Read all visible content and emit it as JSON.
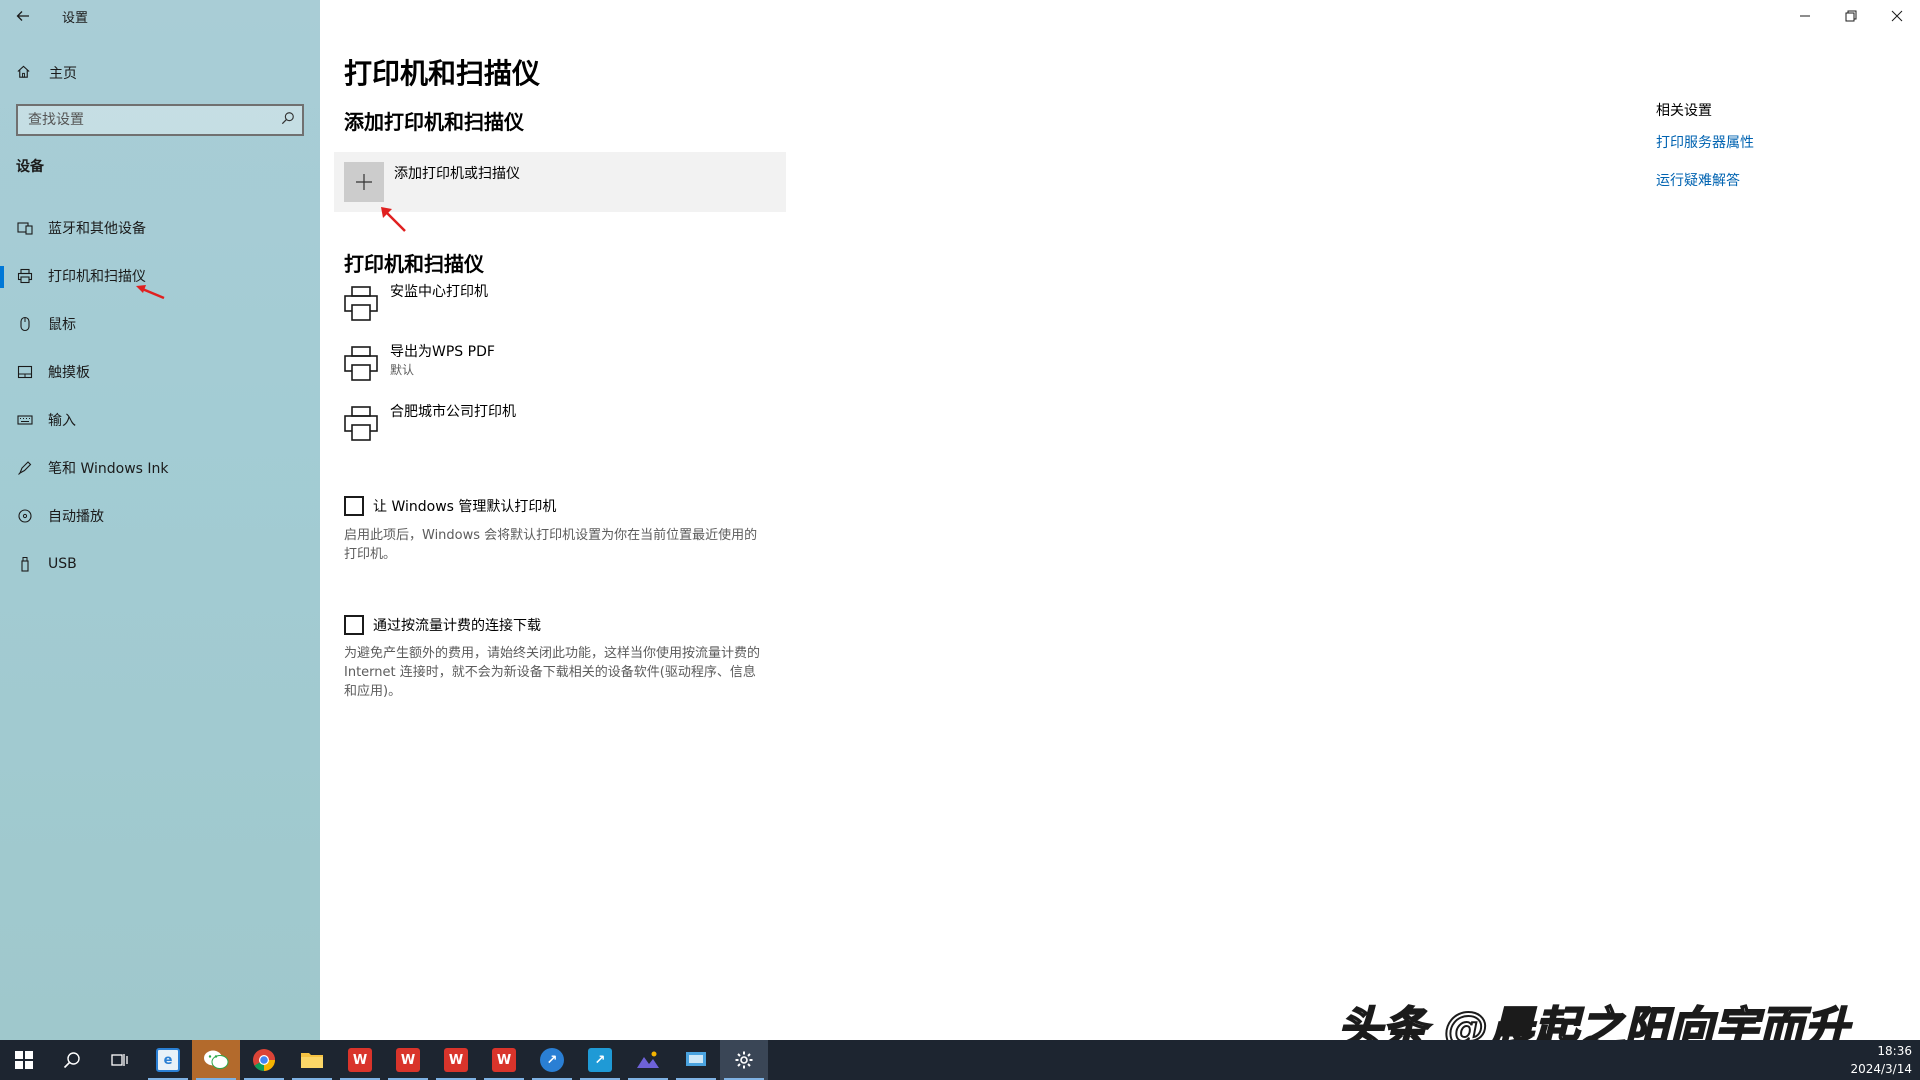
{
  "window": {
    "title": "设置"
  },
  "sidebar": {
    "home_label": "主页",
    "search_placeholder": "查找设置",
    "section": "设备",
    "items": [
      {
        "label": "蓝牙和其他设备",
        "icon": "bluetooth-devices-icon"
      },
      {
        "label": "打印机和扫描仪",
        "icon": "printer-icon",
        "active": true
      },
      {
        "label": "鼠标",
        "icon": "mouse-icon"
      },
      {
        "label": "触摸板",
        "icon": "touchpad-icon"
      },
      {
        "label": "输入",
        "icon": "keyboard-icon"
      },
      {
        "label": "笔和 Windows Ink",
        "icon": "pen-icon"
      },
      {
        "label": "自动播放",
        "icon": "autoplay-icon"
      },
      {
        "label": "USB",
        "icon": "usb-icon"
      }
    ]
  },
  "main": {
    "title": "打印机和扫描仪",
    "add_section_title": "添加打印机和扫描仪",
    "add_button_label": "添加打印机或扫描仪",
    "printers_section_title": "打印机和扫描仪",
    "printers": [
      {
        "name": "安监中心打印机",
        "status": ""
      },
      {
        "name": "导出为WPS PDF",
        "status": "默认"
      },
      {
        "name": "合肥城市公司打印机",
        "status": ""
      }
    ],
    "manage_default": {
      "label": "让 Windows 管理默认打印机",
      "description_line1": "启用此项后，Windows 会将默认打印机设置为你在当前位置最近使用的",
      "description_line2": "打印机。"
    },
    "metered": {
      "label": "通过按流量计费的连接下载",
      "description_line1": "为避免产生额外的费用，请始终关闭此功能，这样当你使用按流量计费的",
      "description_line2": "Internet 连接时，就不会为新设备下载相关的设备软件(驱动程序、信息",
      "description_line3": "和应用)。"
    }
  },
  "related": {
    "heading": "相关设置",
    "links": [
      "打印服务器属性",
      "运行疑难解答"
    ]
  },
  "watermark": "头条 @晨起之阳向宇而升",
  "taskbar": {
    "time": "18:36",
    "date": "2024/3/14"
  }
}
